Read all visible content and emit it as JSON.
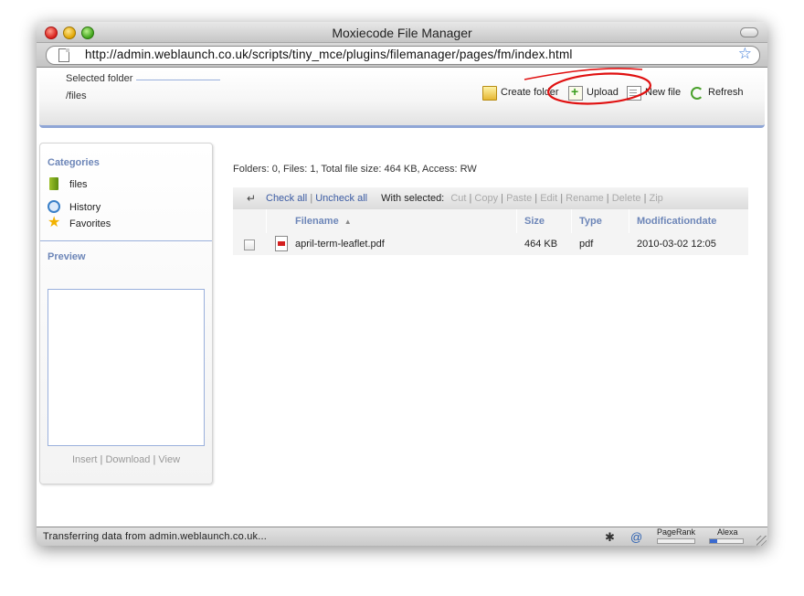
{
  "window": {
    "title": "Moxiecode File Manager",
    "url": "http://admin.weblaunch.co.uk/scripts/tiny_mce/plugins/filemanager/pages/fm/index.html"
  },
  "header": {
    "selected_folder_label": "Selected folder",
    "selected_folder_value": "/files",
    "toolbar": {
      "create_folder": "Create folder",
      "upload": "Upload",
      "new_file": "New file",
      "refresh": "Refresh"
    }
  },
  "sidebar": {
    "categories_title": "Categories",
    "categories": [
      {
        "label": "files",
        "icon": "folder-green-icon"
      },
      {
        "label": "History",
        "icon": "clock-icon"
      },
      {
        "label": "Favorites",
        "icon": "star-icon"
      }
    ],
    "preview_title": "Preview",
    "actions": {
      "insert": "Insert",
      "download": "Download",
      "view": "View"
    }
  },
  "main": {
    "info": "Folders: 0, Files: 1, Total file size: 464 KB, Access: RW",
    "actions_bar": {
      "check_all": "Check all",
      "uncheck_all": "Uncheck all",
      "with_selected": "With selected:",
      "cut": "Cut",
      "copy": "Copy",
      "paste": "Paste",
      "edit": "Edit",
      "rename": "Rename",
      "delete": "Delete",
      "zip": "Zip"
    },
    "columns": {
      "filename": "Filename",
      "size": "Size",
      "type": "Type",
      "modification_date": "Modificationdate"
    },
    "files": [
      {
        "name": "april-term-leaflet.pdf",
        "size": "464 KB",
        "type": "pdf",
        "modified": "2010-03-02 12:05"
      }
    ]
  },
  "statusbar": {
    "text": "Transferring data from admin.weblaunch.co.uk...",
    "pagerank_label": "PageRank",
    "alexa_label": "Alexa"
  },
  "colors": {
    "link": "#3c5ca4",
    "section_title": "#6d86b8",
    "accent_line": "#8fa6d6",
    "annotation": "#e01010"
  }
}
